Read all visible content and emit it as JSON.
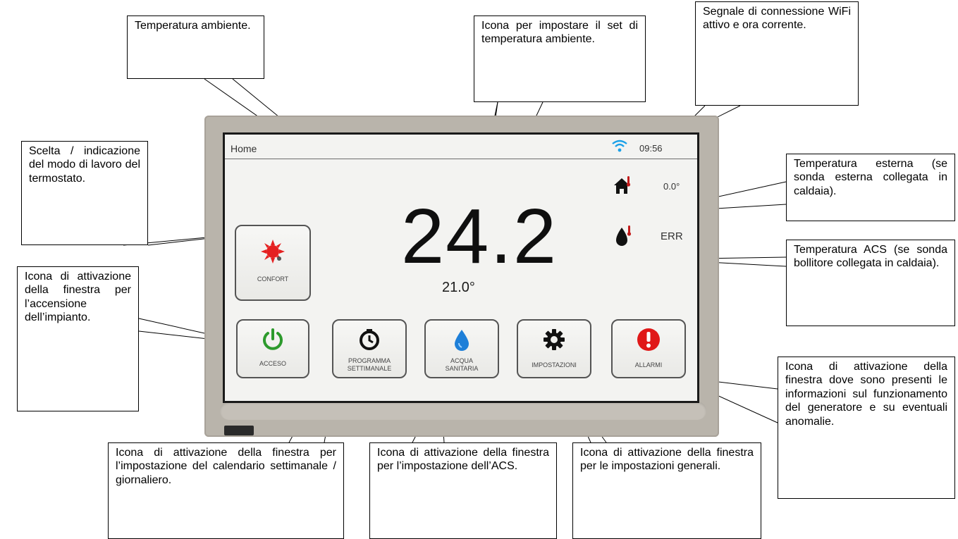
{
  "screen": {
    "title": "Home",
    "clock": "09:56",
    "outdoor_temp": "0.0°",
    "acs_temp": "ERR",
    "room_temp": "24.2",
    "set_temp": "21.0°",
    "mode_button": {
      "label": "CONFORT"
    },
    "buttons": [
      {
        "label_lines": [
          "ACCESO"
        ]
      },
      {
        "label_lines": [
          "PROGRAMMA",
          "SETTIMANALE"
        ]
      },
      {
        "label_lines": [
          "ACQUA",
          "SANITARIA"
        ]
      },
      {
        "label_lines": [
          "IMPOSTAZIONI"
        ]
      },
      {
        "label_lines": [
          "ALLARMI"
        ]
      }
    ]
  },
  "callouts": {
    "room_temp": "Temperatura ambiente.",
    "set_temp_icon": "Icona per impostare il set di temperatura ambiente.",
    "wifi_time": "Segnale di connessione WiFi attivo e ora corrente.",
    "mode": "Scelta / indicazione del modo di lavoro del termostato.",
    "outdoor_temp": "Temperatura esterna (se sonda esterna collegata in caldaia).",
    "acs_temp": "Temperatura ACS (se sonda bollitore collegata in caldaia).",
    "power": "Icona di attivazione della finestra per l’accensione dell’impianto.",
    "weekly": "Icona di attivazione della finestra per l’impostazione del calendario settimanale / giornaliero.",
    "acs_window": "Icona di attivazione della finestra per l’impostazione dell’ACS.",
    "settings": "Icona di attivazione della finestra per le impostazioni generali.",
    "alarms": "Icona di attivazione della finestra dove sono presenti le informazioni sul funzionamento del generatore e su eventuali anomalie."
  },
  "colors": {
    "power_icon": "#2c9a2c",
    "water_icon": "#1e7fd8",
    "alarm_icon": "#e01818",
    "sun_icon": "#e52020",
    "wifi_icon": "#1aa0e8"
  },
  "icons": [
    "wifi-icon",
    "house-thermometer-icon",
    "drop-thermometer-icon",
    "sun-icon",
    "power-icon",
    "clock-icon",
    "water-drop-icon",
    "gear-icon",
    "alarm-icon"
  ]
}
